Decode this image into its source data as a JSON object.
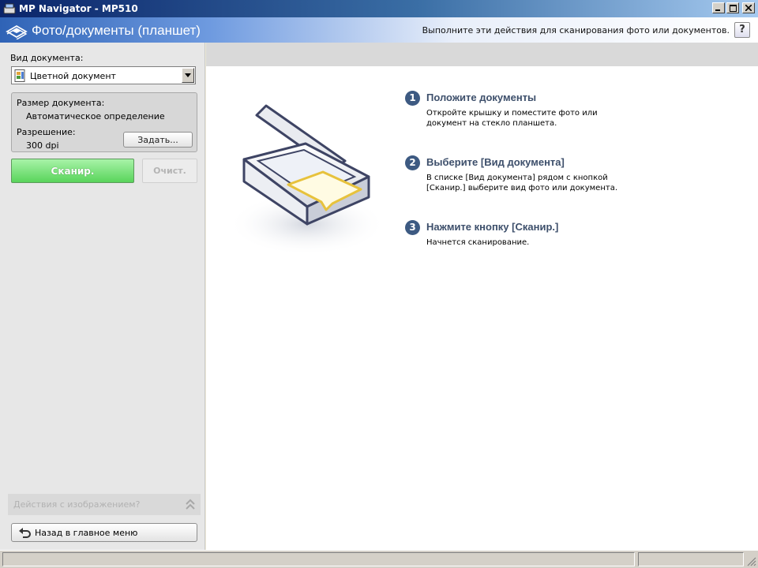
{
  "window": {
    "title": "MP Navigator - MP510"
  },
  "header": {
    "title": "Фото/документы (планшет)",
    "instruction": "Выполните эти действия для сканирования фото или документов.",
    "help_label": "?"
  },
  "left_panel": {
    "doc_type_label": "Вид документа:",
    "doc_type_value": "Цветной документ",
    "size_label": "Размер документа:",
    "size_value": "Автоматическое определение",
    "resolution_label": "Разрешение:",
    "resolution_value": "300 dpi",
    "set_button": "Задать...",
    "scan_button": "Сканир.",
    "clear_button": "Очист.",
    "actions_label": "Действия с изображением?",
    "back_button": "Назад в главное меню"
  },
  "steps": [
    {
      "number": "1",
      "title": "Положите документы",
      "text": "Откройте крышку и поместите фото или документ на стекло планшета."
    },
    {
      "number": "2",
      "title": "Выберите [Вид документа]",
      "text": "В списке [Вид документа] рядом с кнопкой [Сканир.] выберите вид фото или документа."
    },
    {
      "number": "3",
      "title": "Нажмите кнопку [Сканир.]",
      "text": "Начнется сканирование."
    }
  ],
  "colors": {
    "scan_button": "#59d45b",
    "step_number": "#3d5a82",
    "header_blue": "#2f63b6"
  }
}
